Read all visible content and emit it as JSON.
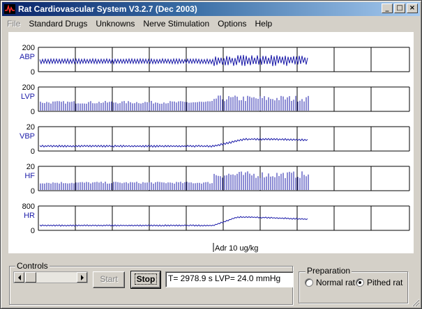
{
  "window": {
    "title": "Rat Cardiovascular System V3.2.7 (Dec 2003)",
    "buttons": {
      "minimize": "_",
      "maximize": "□",
      "close": "×"
    }
  },
  "menu": {
    "file": "File",
    "standard_drugs": "Standard Drugs",
    "unknowns": "Unknowns",
    "nerve_stimulation": "Nerve Stimulation",
    "options": "Options",
    "help": "Help"
  },
  "plot": {
    "trace_color": "#1a1aa8",
    "channels": [
      {
        "name": "ABP",
        "max": "200",
        "min": "0"
      },
      {
        "name": "LVP",
        "max": "200",
        "min": "0"
      },
      {
        "name": "VBP",
        "max": "20",
        "min": "0"
      },
      {
        "name": "HF",
        "max": "20",
        "min": "0"
      },
      {
        "name": "HR",
        "max": "800",
        "min": "0"
      }
    ],
    "event_marker": "Adr 10 ug/kg"
  },
  "controls": {
    "group_label": "Controls",
    "start_label": "Start",
    "stop_label": "Stop",
    "status_text": "T= 2978.9 s LVP= 24.0 mmHg"
  },
  "preparation": {
    "group_label": "Preparation",
    "options": [
      "Normal rat",
      "Pithed rat"
    ],
    "selected": "Pithed rat"
  }
}
